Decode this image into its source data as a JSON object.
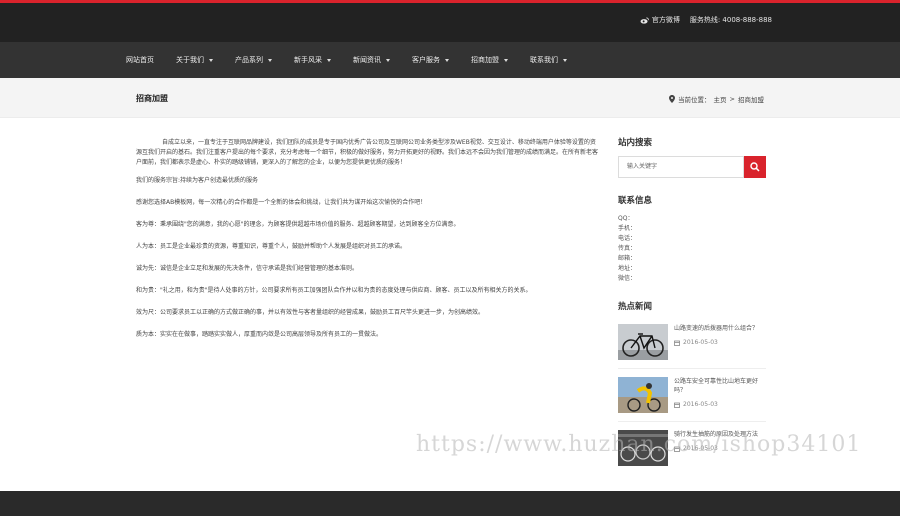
{
  "topbar": {
    "weibo": "官方微博",
    "hotline": "服务热线: 4008-888-888"
  },
  "nav": {
    "items": [
      {
        "label": "网站首页",
        "dropdown": false
      },
      {
        "label": "关于我们",
        "dropdown": true
      },
      {
        "label": "产品系列",
        "dropdown": true
      },
      {
        "label": "新手风采",
        "dropdown": true
      },
      {
        "label": "新闻资讯",
        "dropdown": true
      },
      {
        "label": "客户服务",
        "dropdown": true
      },
      {
        "label": "招商加盟",
        "dropdown": true
      },
      {
        "label": "联系我们",
        "dropdown": true
      }
    ]
  },
  "breadcrumb": {
    "title": "招商加盟",
    "location_label": "当前位置：",
    "home": "主页",
    "sep": ">",
    "current": "招商加盟"
  },
  "article": {
    "intro": "自成立以来，一直专注于互联网品牌建设，我们团队的成员是专于国内优秀广告公司及互联网公司业务类型涉及WEB视觉、交互设计、移动终端用户体验等设置的资源互我们开启的基石。我们注重客户提出的每个要求，充分考虑每一个细节，积极的做好服务，努力开拓更好的视野。我们本远不会因为我们管理的成绩而满足。在所有新老客户面前，我们都表示是虚心、朴实的踏级铺铺，更深入的了解您的企业，以便为您提供更优质的服务！",
    "line1": "我们的服务宗旨:持续为客户创造最优质的服务",
    "line2": "感谢您选择AB模板网，每一次精心的合作都是一个全新的体会和挑战，让我们共为谋开始这次愉快的合作吧！",
    "values": [
      "客为尊：秉承围绕\"您的满意，我的心愿\"的理念，为顾客提供超越市场价值的服务、超越顾客期望，达到顾客全方位满意。",
      "人为本：员工是企业最珍贵的资源，尊重知识，尊重个人，鼓励并帮助个人发展是组织对员工的承诺。",
      "诚为先：诚信是企业立足和发展的先决条件，信守承诺是我们经营管理的基本准则。",
      "和为贵：\"礼之用，和为贵\"是待人处事的方针，公司要求所有员工加强团队合作并以和为贵的态度处理与供应商、顾客、员工以及所有相关方的关系。",
      "效为尺：公司要求员工以正确的方式做正确的事，并以有效性与客者量组织的经营成果，鼓励员工百尺竿头更进一步，为创高绩效。",
      "质为本：实实在在做事，踏踏实实做人，厚重而内敛是公司高层领导及所有员工的一贯做法。"
    ]
  },
  "sidebar": {
    "search_title": "站内搜索",
    "search_placeholder": "输入关键字",
    "contact_title": "联系信息",
    "contact_lines": [
      "QQ：",
      "手机：",
      "电话：",
      "传真：",
      "邮箱：",
      "地址：",
      "微信："
    ],
    "news_title": "热点新闻",
    "news": [
      {
        "title": "山路变速的后拨器用什么组合？",
        "date": "2016-05-03",
        "icon": "road-bike-photo"
      },
      {
        "title": "公路车安全可靠性比山地车更好吗？",
        "date": "2016-05-03",
        "icon": "cyclist-photo"
      },
      {
        "title": "骑行发生抽筋的原因及处理方法",
        "date": "2016-05-03",
        "icon": "bike-rack-photo"
      }
    ]
  },
  "watermark": "https://www.huzhan.com/ishop34101",
  "colors": {
    "accent": "#d9232c",
    "topbar": "#222222",
    "nav": "#333333",
    "footer": "#2a2a2a"
  }
}
